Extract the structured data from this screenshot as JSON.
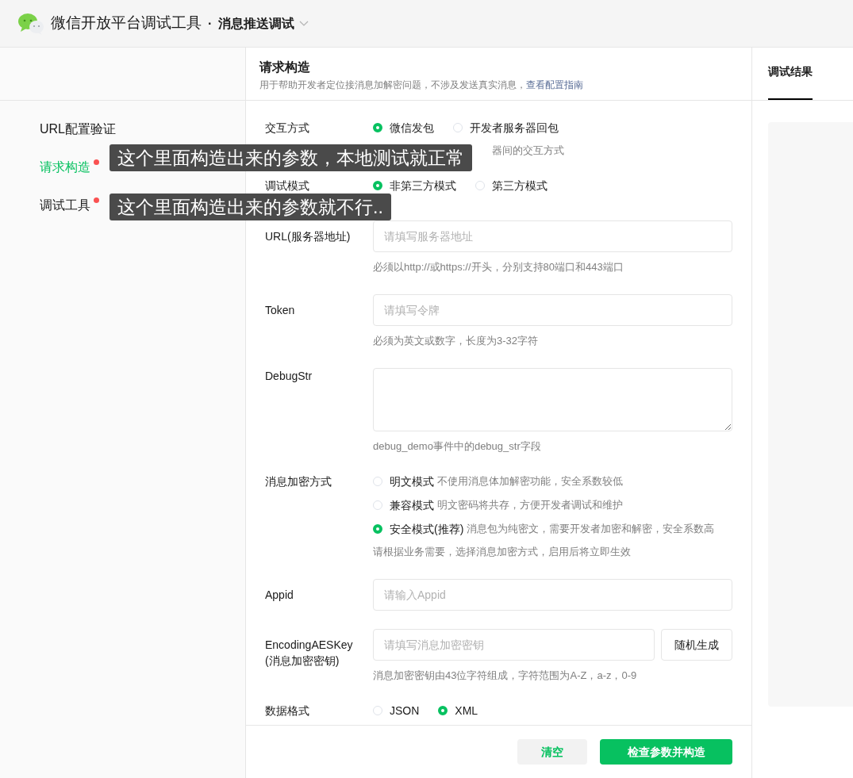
{
  "header": {
    "title": "微信开放平台调试工具",
    "separator": "·",
    "subtitle": "消息推送调试"
  },
  "sidebar": {
    "items": [
      {
        "label": "URL配置验证",
        "selected": false,
        "flagged": false
      },
      {
        "label": "请求构造",
        "selected": true,
        "flagged": true
      },
      {
        "label": "调试工具",
        "selected": false,
        "flagged": true
      }
    ]
  },
  "panel": {
    "title": "请求构造",
    "description": "用于帮助开发者定位接消息加解密问题，不涉及发送真实消息，",
    "link": "查看配置指南"
  },
  "fields": [
    {
      "kind": "radio",
      "label": "交互方式",
      "options": [
        {
          "label": "微信发包",
          "selected": true
        },
        {
          "label": "开发者服务器回包",
          "selected": false
        }
      ],
      "hint": "器间的交互方式",
      "hint_covered": true
    },
    {
      "kind": "radio",
      "label": "调试模式",
      "options": [
        {
          "label": "非第三方模式",
          "selected": true
        },
        {
          "label": "第三方模式",
          "selected": false
        }
      ]
    },
    {
      "kind": "input",
      "label": "URL(服务器地址)",
      "placeholder": "请填写服务器地址",
      "hint": "必须以http://或https://开头，分别支持80端口和443端口"
    },
    {
      "kind": "input",
      "label": "Token",
      "placeholder": "请填写令牌",
      "hint": "必须为英文或数字，长度为3-32字符"
    },
    {
      "kind": "textarea",
      "label": "DebugStr",
      "hint": "debug_demo事件中的debug_str字段"
    },
    {
      "kind": "radio_list",
      "label": "消息加密方式",
      "options": [
        {
          "label": "明文模式",
          "desc": "不使用消息体加解密功能，安全系数较低",
          "selected": false
        },
        {
          "label": "兼容模式",
          "desc": "明文密码将共存，方便开发者调试和维护",
          "selected": false
        },
        {
          "label": "安全模式(推荐)",
          "desc": "消息包为纯密文，需要开发者加密和解密，安全系数高",
          "selected": true
        }
      ],
      "hint": "请根据业务需要，选择消息加密方式，启用后将立即生效"
    },
    {
      "kind": "input",
      "label": "Appid",
      "placeholder": "请输入Appid"
    },
    {
      "kind": "input_button",
      "label": "EncodingAESKey",
      "label_note": "(消息加密密钥)",
      "placeholder": "请填写消息加密密钥",
      "button": "随机生成",
      "hint": "消息加密密钥由43位字符组成，字符范围为A-Z，a-z，0-9"
    },
    {
      "kind": "radio",
      "label": "数据格式",
      "options": [
        {
          "label": "JSON",
          "selected": false
        },
        {
          "label": "XML",
          "selected": true
        }
      ]
    }
  ],
  "buttons": {
    "clear": "清空",
    "submit": "检查参数并构造"
  },
  "result_tab": {
    "label": "调试结果",
    "selected": true
  },
  "annotations": [
    {
      "text": "这个里面构造出来的参数，本地测试就正常"
    },
    {
      "text": "这个里面构造出来的参数就不行.."
    }
  ]
}
